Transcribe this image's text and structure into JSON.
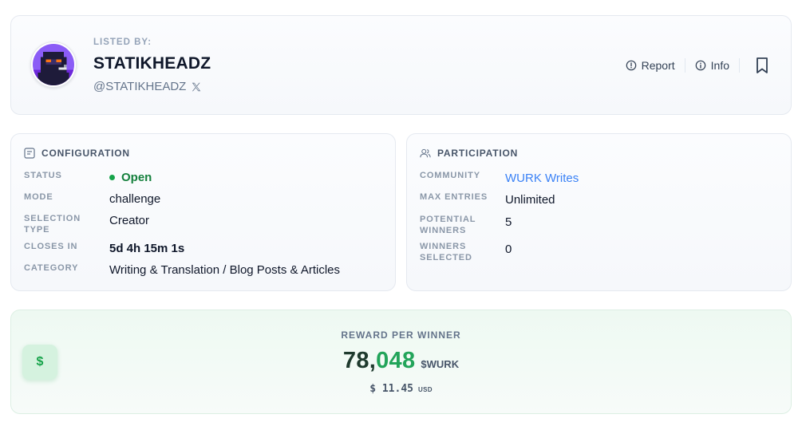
{
  "lister": {
    "label": "LISTED BY:",
    "name": "STATIKHEADZ",
    "handle": "@STATIKHEADZ",
    "avatar_icon": "pixel-hooded-figure-avatar",
    "social_icon": "x-logo-icon"
  },
  "actions": {
    "report_label": "Report",
    "info_label": "Info",
    "bookmark_icon": "bookmark-icon"
  },
  "configuration": {
    "title": "CONFIGURATION",
    "rows": [
      {
        "label": "STATUS",
        "value": "Open"
      },
      {
        "label": "MODE",
        "value": "challenge"
      },
      {
        "label": "SELECTION TYPE",
        "value": "Creator"
      },
      {
        "label": "CLOSES IN",
        "value": "5d 4h 15m 1s"
      },
      {
        "label": "CATEGORY",
        "value": "Writing & Translation / Blog Posts & Articles"
      }
    ]
  },
  "participation": {
    "title": "PARTICIPATION",
    "rows": [
      {
        "label": "COMMUNITY",
        "value": "WURK Writes"
      },
      {
        "label": "MAX ENTRIES",
        "value": "Unlimited"
      },
      {
        "label": "POTENTIAL WINNERS",
        "value": "5"
      },
      {
        "label": "WINNERS SELECTED",
        "value": "0"
      }
    ]
  },
  "reward": {
    "label": "REWARD PER WINNER",
    "amount_prefix": "78,",
    "amount_suffix": "048",
    "token": "$WURK",
    "usd_value": "$ 11.45",
    "usd_unit": "USD",
    "icon_glyph": "$"
  },
  "colors": {
    "status_open": "#15803d",
    "link": "#3b82f6",
    "reward_green": "#22a45a"
  }
}
